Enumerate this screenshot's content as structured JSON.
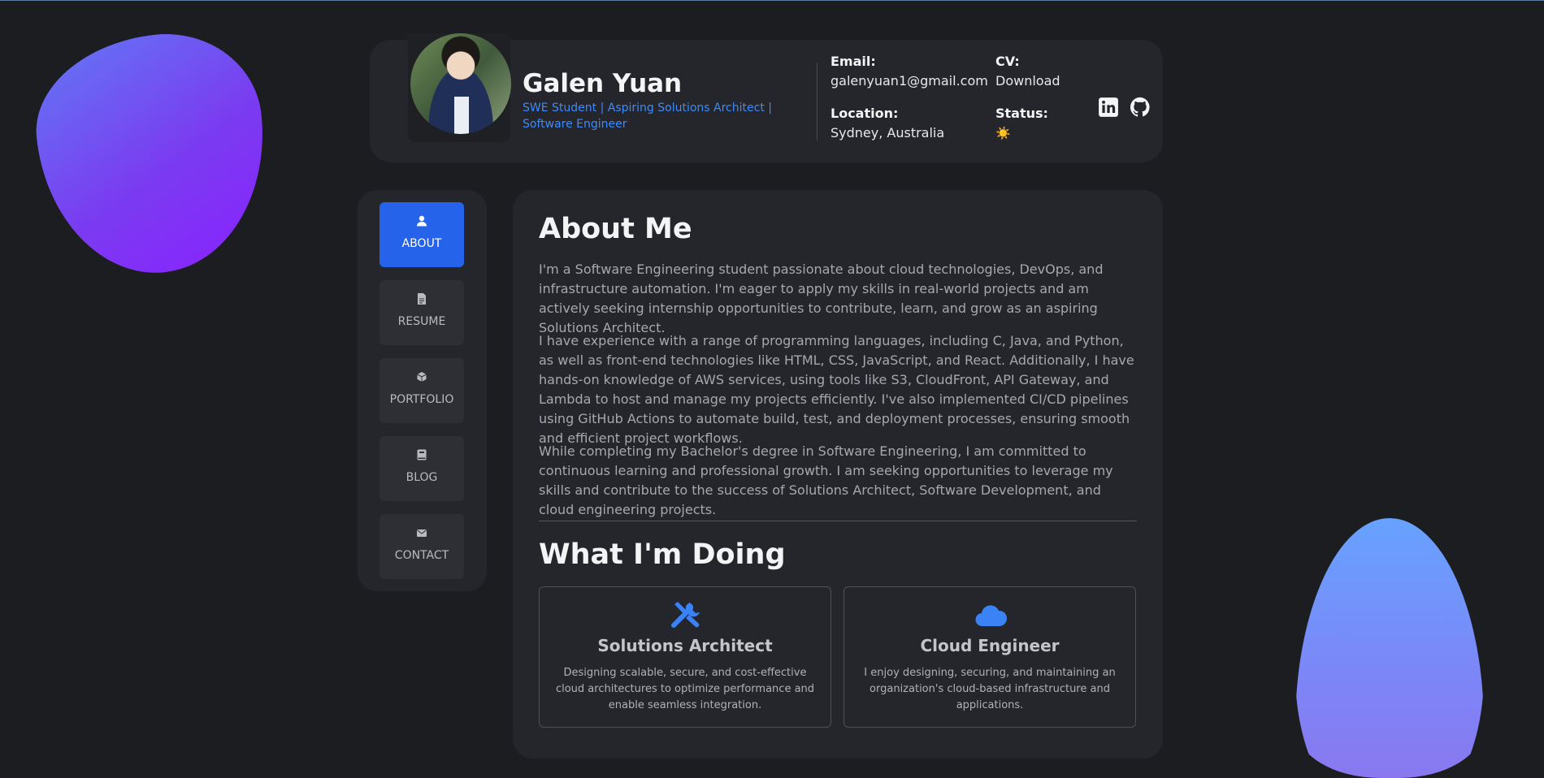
{
  "profile": {
    "name": "Galen Yuan",
    "tagline": "SWE Student | Aspiring Solutions Architect | Software Engineer"
  },
  "contact_info": {
    "email_label": "Email:",
    "email": "galenyuan1@gmail.com",
    "cv_label": "CV:",
    "cv_link": "Download",
    "location_label": "Location:",
    "location": "Sydney, Australia",
    "status_label": "Status:",
    "status_icon": "☀️"
  },
  "social": [
    {
      "icon": "linkedin-icon"
    },
    {
      "icon": "github-icon"
    }
  ],
  "nav": {
    "items": [
      {
        "label": "ABOUT",
        "icon": "user-icon",
        "active": true
      },
      {
        "label": "RESUME",
        "icon": "file-icon",
        "active": false
      },
      {
        "label": "PORTFOLIO",
        "icon": "cube-icon",
        "active": false
      },
      {
        "label": "BLOG",
        "icon": "book-icon",
        "active": false
      },
      {
        "label": "CONTACT",
        "icon": "envelope-icon",
        "active": false
      }
    ]
  },
  "about": {
    "heading": "About Me",
    "paragraphs": [
      "I'm a Software Engineering student passionate about cloud technologies, DevOps, and infrastructure automation. I'm eager to apply my skills in real-world projects and am actively seeking internship opportunities to contribute, learn, and grow as an aspiring Solutions Architect.",
      "I have experience with a range of programming languages, including C, Java, and Python, as well as front-end technologies like HTML, CSS, JavaScript, and React. Additionally, I have hands-on knowledge of AWS services, using tools like S3, CloudFront, API Gateway, and Lambda to host and manage my projects efficiently. I've also implemented CI/CD pipelines using GitHub Actions to automate build, test, and deployment processes, ensuring smooth and efficient project workflows.",
      "While completing my Bachelor's degree in Software Engineering, I am committed to continuous learning and professional growth. I am seeking opportunities to leverage my skills and contribute to the success of Solutions Architect, Software Development, and cloud engineering projects."
    ]
  },
  "doing": {
    "heading": "What I'm Doing",
    "services": [
      {
        "icon": "tools-icon",
        "title": "Solutions Architect",
        "description": "Designing scalable, secure, and cost-effective cloud architectures to optimize performance and enable seamless integration."
      },
      {
        "icon": "cloud-icon",
        "title": "Cloud Engineer",
        "description": "I enjoy designing, securing, and maintaining an organization's cloud-based infrastructure and applications."
      }
    ]
  },
  "colors": {
    "accent": "#2563eb",
    "tagline": "#3b8bff",
    "background": "#1c1d21",
    "card": "#25262b"
  }
}
